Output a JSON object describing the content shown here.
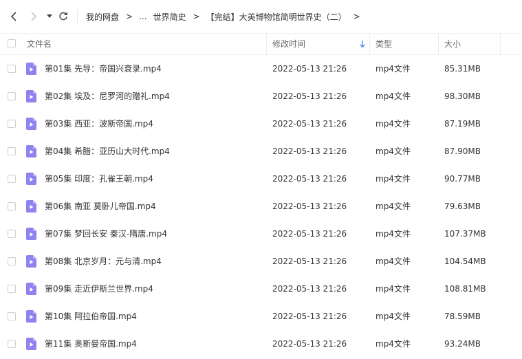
{
  "nav": {
    "back_icon": "chevron-left-icon",
    "forward_icon": "chevron-right-icon",
    "dropdown_icon": "caret-down-icon",
    "refresh_icon": "refresh-icon",
    "breadcrumb": [
      "我的网盘",
      "...",
      "世界简史",
      "【完结】大英博物馆简明世界史（二）"
    ],
    "separator": ">"
  },
  "columns": {
    "name": "文件名",
    "modified": "修改时间",
    "type": "类型",
    "size": "大小",
    "sort_icon": "sort-down-arrow-icon"
  },
  "colors": {
    "accent": "#3b8cff",
    "file_icon": "#8f83f0"
  },
  "files": [
    {
      "name": "第01集 先导：帝国兴衰录.mp4",
      "modified": "2022-05-13 21:26",
      "type": "mp4文件",
      "size": "85.31MB"
    },
    {
      "name": "第02集 埃及：尼罗河的赠礼.mp4",
      "modified": "2022-05-13 21:26",
      "type": "mp4文件",
      "size": "98.30MB"
    },
    {
      "name": "第03集 西亚：波斯帝国.mp4",
      "modified": "2022-05-13 21:26",
      "type": "mp4文件",
      "size": "87.19MB"
    },
    {
      "name": "第04集 希腊：亚历山大时代.mp4",
      "modified": "2022-05-13 21:26",
      "type": "mp4文件",
      "size": "87.90MB"
    },
    {
      "name": "第05集 印度：孔雀王朝.mp4",
      "modified": "2022-05-13 21:26",
      "type": "mp4文件",
      "size": "90.77MB"
    },
    {
      "name": "第06集 南亚 莫卧儿帝国.mp4",
      "modified": "2022-05-13 21:26",
      "type": "mp4文件",
      "size": "79.63MB"
    },
    {
      "name": "第07集 梦回长安 秦汉-隋唐.mp4",
      "modified": "2022-05-13 21:26",
      "type": "mp4文件",
      "size": "107.37MB"
    },
    {
      "name": "第08集 北京岁月：元与清.mp4",
      "modified": "2022-05-13 21:26",
      "type": "mp4文件",
      "size": "104.54MB"
    },
    {
      "name": "第09集 走近伊斯兰世界.mp4",
      "modified": "2022-05-13 21:26",
      "type": "mp4文件",
      "size": "108.81MB"
    },
    {
      "name": "第10集 阿拉伯帝国.mp4",
      "modified": "2022-05-13 21:26",
      "type": "mp4文件",
      "size": "78.59MB"
    },
    {
      "name": "第11集 奥斯曼帝国.mp4",
      "modified": "2022-05-13 21:26",
      "type": "mp4文件",
      "size": "93.24MB"
    }
  ]
}
